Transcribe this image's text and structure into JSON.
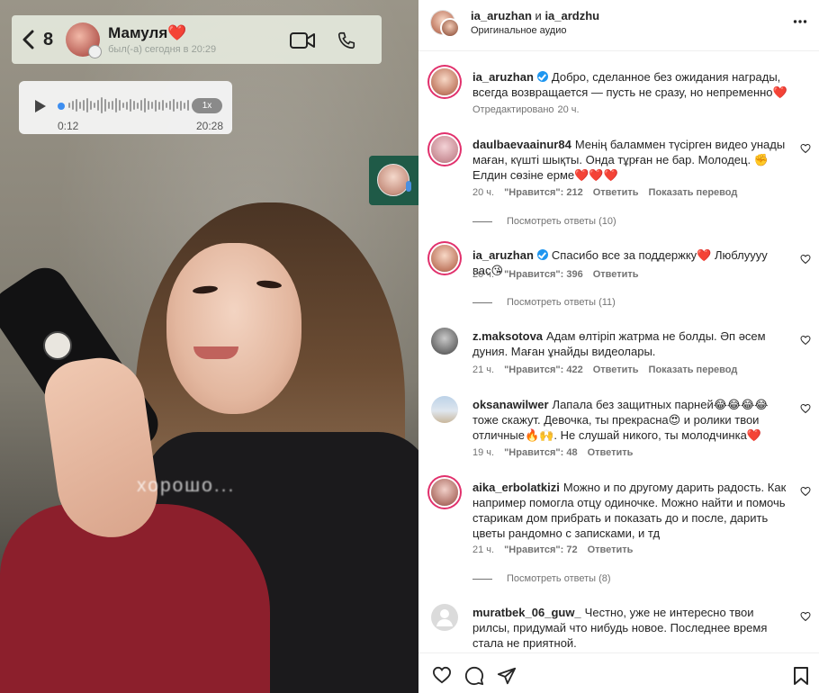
{
  "video": {
    "chat": {
      "back_count": "8",
      "contact_name": "Мамуля❤️",
      "status": "был(-а) сегодня в 20:29"
    },
    "voice_message": {
      "speed": "1x",
      "elapsed": "0:12",
      "total": "20:28"
    },
    "subtitle": "хорошо..."
  },
  "post": {
    "author": "ia_aruzhan",
    "connector": "и",
    "coauthor": "ia_ardzhu",
    "audio": "Оригинальное аудио"
  },
  "caption": {
    "user": "ia_aruzhan",
    "text": "Добро, сделанное без ожидания награды, всегда возвращается — пусть не сразу, но непременно❤️",
    "edited": "Отредактировано",
    "time": "20 ч."
  },
  "comments": [
    {
      "user": "daulbaevaainur84",
      "text": "Менің баламмен түсірген видео унады маған, күшті шықты. Онда тұрған не бар. Молодец. ✊ Елдин сөзіне ерме❤️❤️❤️",
      "time": "20 ч.",
      "likes": "\"Нравится\": 212",
      "reply": "Ответить",
      "translate": "Показать перевод",
      "replies": "Посмотреть ответы (10)"
    },
    {
      "user": "ia_aruzhan",
      "verified": true,
      "text": "Спасибо все за поддержку❤️ Люблуууу вас😘",
      "time": "20 ч.",
      "likes": "\"Нравится\": 396",
      "reply": "Ответить",
      "replies": "Посмотреть ответы (11)"
    },
    {
      "user": "z.maksotova",
      "text": "Адам өлтіріп жатрма не болды. Әп әсем дуния. Маған ұнайды видеолары.",
      "time": "21 ч.",
      "likes": "\"Нравится\": 422",
      "reply": "Ответить",
      "translate": "Показать перевод"
    },
    {
      "user": "oksanawilwer",
      "text": "Лапала без защитных парней😂😂😂😂 тоже скажут. Девочка, ты прекрасна😍 и ролики твои отличные🔥🙌. Не слушай никого, ты молодчинка❤️",
      "time": "19 ч.",
      "likes": "\"Нравится\": 48",
      "reply": "Ответить"
    },
    {
      "user": "aika_erbolatkizi",
      "text": "Можно и по другому дарить радость. Как например помогла отцу одиночке. Можно найти и помочь старикам дом прибрать и показать до и после, дарить цветы рандомно с записками, и тд",
      "time": "21 ч.",
      "likes": "\"Нравится\": 72",
      "reply": "Ответить",
      "replies": "Посмотреть ответы (8)"
    },
    {
      "user": "muratbek_06_guw_",
      "text": "Честно, уже не интересно твои рилсы, придумай что нибудь новое. Последнее время стала не приятной."
    }
  ]
}
